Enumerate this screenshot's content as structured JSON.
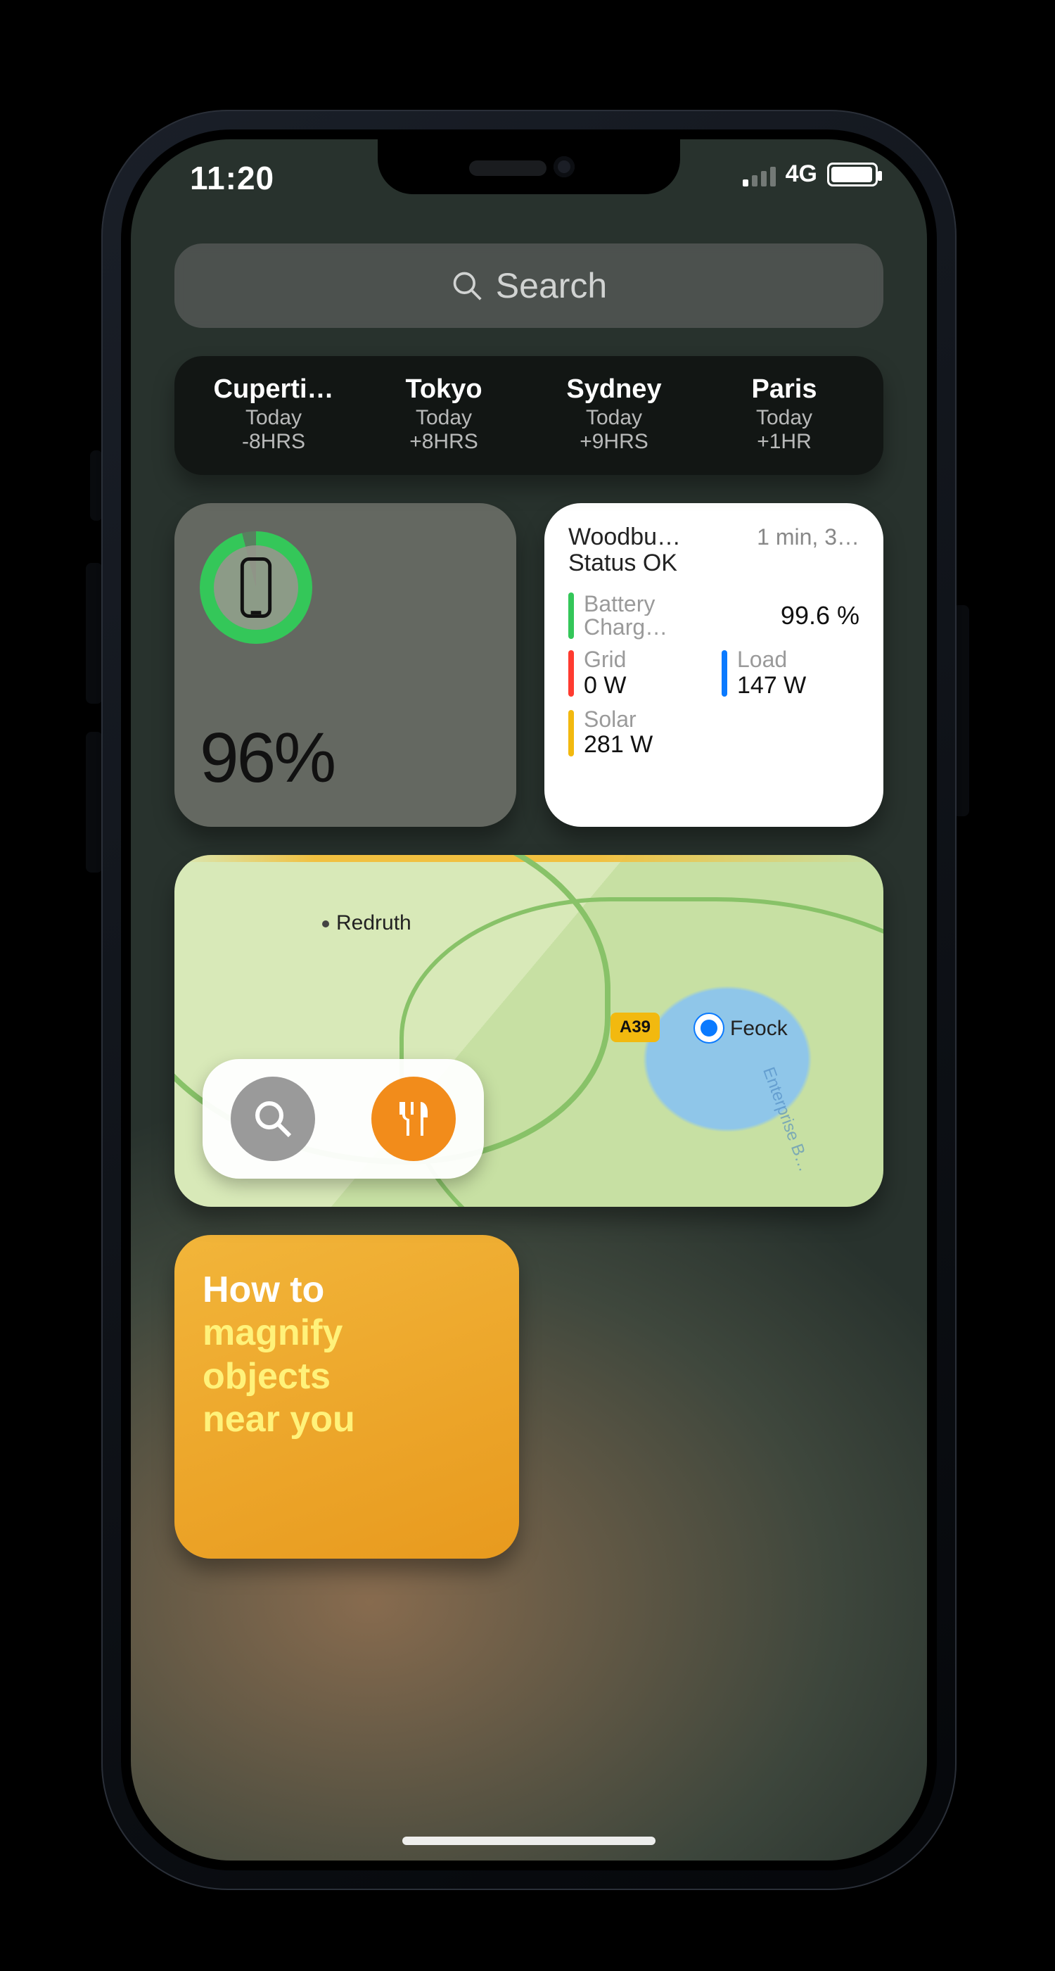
{
  "status": {
    "time": "11:20",
    "network": "4G"
  },
  "search": {
    "placeholder": "Search"
  },
  "world_clock": {
    "cities": [
      {
        "name": "Cuperti…",
        "day": "Today",
        "offset": "-8HRS"
      },
      {
        "name": "Tokyo",
        "day": "Today",
        "offset": "+8HRS"
      },
      {
        "name": "Sydney",
        "day": "Today",
        "offset": "+9HRS"
      },
      {
        "name": "Paris",
        "day": "Today",
        "offset": "+1HR"
      }
    ]
  },
  "battery_widget": {
    "percent_label": "96%",
    "ring_percent": 96
  },
  "energy_widget": {
    "site": "Woodbu…",
    "status": "Status OK",
    "updated": "1 min, 3…",
    "battery": {
      "label": "Battery",
      "sub": "Charg…",
      "value": "99.6 %",
      "color": "#34c759"
    },
    "grid": {
      "label": "Grid",
      "value": "0 W",
      "color": "#ff3b30"
    },
    "load": {
      "label": "Load",
      "value": "147 W",
      "color": "#0a7aff"
    },
    "solar": {
      "label": "Solar",
      "value": "281 W",
      "color": "#f2b90f"
    }
  },
  "map_widget": {
    "place1": "Redruth",
    "place2": "Feock",
    "road_shield": "A39",
    "river": "Enterprise B…"
  },
  "tips_widget": {
    "line1": "How to",
    "line2": "magnify",
    "line3": "objects",
    "line4": "near you"
  }
}
